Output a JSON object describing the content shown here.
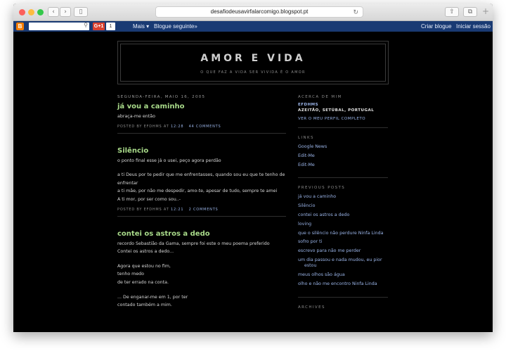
{
  "browser": {
    "url": "desafiodeusavirfalarcomigo.blogspot.pt",
    "colors": {
      "close": "#fc605c",
      "minimize": "#fdbc40",
      "maximize": "#34c84a"
    }
  },
  "navbar": {
    "logo": "B",
    "gplus_label": "G+1",
    "gplus_count": "1",
    "more_label": "Mais ▾",
    "next_blog_label": "Blogue seguinte»",
    "create_blog_label": "Criar blogue",
    "sign_in_label": "Iniciar sessão"
  },
  "header": {
    "title": "AMOR E VIDA",
    "description": "O QUE FAZ A VIDA SER VIVIDA É O AMOR"
  },
  "main": {
    "date_header": "SEGUNDA-FEIRA, MAIO 16, 2005",
    "posts": [
      {
        "title": "já vou a caminho",
        "body": [
          "abraça-me então"
        ],
        "footer_prefix": "POSTED BY EFDHMS AT",
        "time": "12:28",
        "comments": "44 COMMENTS"
      },
      {
        "title": "Silêncio",
        "body": [
          "o ponto final esse já o usei, peço agora perdão",
          "",
          "a ti Deus por te pedir que me enfrentasses, quando sou eu que te tenho de enfrentar",
          "a ti mãe, por não me despedir, amo-te, apesar de tudo, sempre te amei",
          "A ti mor, por ser como sou..-"
        ],
        "footer_prefix": "POSTED BY EFDHMS AT",
        "time": "12:21",
        "comments": "2 COMMENTS"
      },
      {
        "title": "contei os astros a dedo",
        "body": [
          "recordo Sebastião da Gama, sempre foi este o meu poema preferido",
          "Contei os astros a dedo...",
          "",
          "Agora que estou no fim,",
          "tenho medo",
          "de ter errado na conta.",
          "",
          "... De enganar-me em 1, por ter",
          "contado também a mim."
        ]
      }
    ]
  },
  "sidebar": {
    "about_heading": "ACERCA DE MIM",
    "profile_name": "EFDHMS",
    "profile_location": "AZEITÃO, SETÚBAL, PORTUGAL",
    "profile_link": "VER O MEU PERFIL COMPLETO",
    "links_heading": "LINKS",
    "links": [
      "Google News",
      "Edit-Me",
      "Edit-Me"
    ],
    "previous_heading": "PREVIOUS POSTS",
    "previous_posts": [
      "já vou a caminho",
      "Silêncio",
      "contei os astros a dedo",
      "loving",
      "que o silêncio não perdure Ninfa Linda",
      "sofro por ti",
      "escrevo para não me perder",
      "um dia passou e nada mudou, eu pior estou",
      "meus olhos são água",
      "olho e não me encontro Ninfa Linda"
    ],
    "archives_heading": "ARCHIVES"
  },
  "colors": {
    "background": "#000000",
    "post_title": "#a9db8a",
    "link": "#9ab4e8",
    "navbar": "#193a73"
  }
}
